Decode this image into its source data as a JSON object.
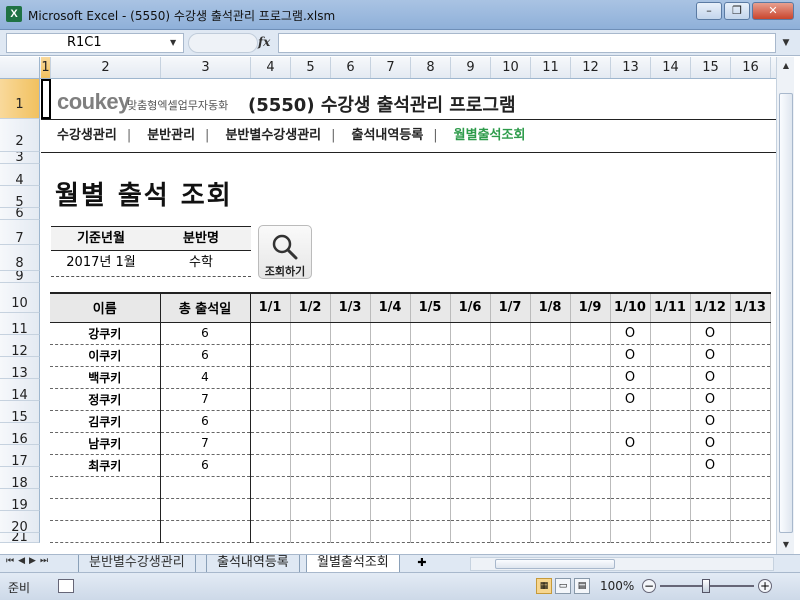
{
  "window": {
    "title": "Microsoft Excel - (5550) 수강생 출석관리 프로그램.xlsm",
    "app_icon": "X",
    "minimize": "–",
    "restore": "❐",
    "close": "✕"
  },
  "formula_bar": {
    "name_box": "R1C1",
    "fx": "fx",
    "formula": ""
  },
  "columns": [
    "1",
    "2",
    "3",
    "4",
    "5",
    "6",
    "7",
    "8",
    "9",
    "10",
    "11",
    "12",
    "13",
    "14",
    "15",
    "16"
  ],
  "rows": [
    "1",
    "2",
    "3",
    "4",
    "5",
    "6",
    "7",
    "8",
    "9",
    "10",
    "11",
    "12",
    "13",
    "14",
    "15",
    "16",
    "17",
    "18",
    "19",
    "20",
    "21"
  ],
  "header": {
    "brand": "coukey",
    "brand_sub": "맞춤형엑셀업무자동화",
    "title": "(5550) 수강생 출석관리 프로그램"
  },
  "menu": {
    "items": [
      "수강생관리",
      "분반관리",
      "분반별수강생관리",
      "출석내역등록",
      "월별출석조회"
    ],
    "separator": "|",
    "active_index": 4
  },
  "page_heading": "월별 출석 조회",
  "filter": {
    "headers": [
      "기준년월",
      "분반명"
    ],
    "values": [
      "2017년 1월",
      "수학"
    ]
  },
  "search_button": {
    "label": "조회하기",
    "icon": "magnifier-icon"
  },
  "attendance": {
    "headers": {
      "name": "이름",
      "total": "총 출석일",
      "days": [
        "1/1",
        "1/2",
        "1/3",
        "1/4",
        "1/5",
        "1/6",
        "1/7",
        "1/8",
        "1/9",
        "1/10",
        "1/11",
        "1/12",
        "1/13"
      ]
    },
    "mark": "O",
    "rows": [
      {
        "name": "강쿠키",
        "total": "6",
        "marks": [
          "",
          "",
          "",
          "",
          "",
          "",
          "",
          "",
          "",
          "O",
          "",
          "O",
          ""
        ]
      },
      {
        "name": "이쿠키",
        "total": "6",
        "marks": [
          "",
          "",
          "",
          "",
          "",
          "",
          "",
          "",
          "",
          "O",
          "",
          "O",
          ""
        ]
      },
      {
        "name": "백쿠키",
        "total": "4",
        "marks": [
          "",
          "",
          "",
          "",
          "",
          "",
          "",
          "",
          "",
          "O",
          "",
          "O",
          ""
        ]
      },
      {
        "name": "정쿠키",
        "total": "7",
        "marks": [
          "",
          "",
          "",
          "",
          "",
          "",
          "",
          "",
          "",
          "O",
          "",
          "O",
          ""
        ]
      },
      {
        "name": "김쿠키",
        "total": "6",
        "marks": [
          "",
          "",
          "",
          "",
          "",
          "",
          "",
          "",
          "",
          "",
          "",
          "O",
          ""
        ]
      },
      {
        "name": "남쿠키",
        "total": "7",
        "marks": [
          "",
          "",
          "",
          "",
          "",
          "",
          "",
          "",
          "",
          "O",
          "",
          "O",
          ""
        ]
      },
      {
        "name": "최쿠키",
        "total": "6",
        "marks": [
          "",
          "",
          "",
          "",
          "",
          "",
          "",
          "",
          "",
          "",
          "",
          "O",
          ""
        ]
      },
      {
        "name": "",
        "total": "",
        "marks": [
          "",
          "",
          "",
          "",
          "",
          "",
          "",
          "",
          "",
          "",
          "",
          "",
          ""
        ]
      },
      {
        "name": "",
        "total": "",
        "marks": [
          "",
          "",
          "",
          "",
          "",
          "",
          "",
          "",
          "",
          "",
          "",
          "",
          ""
        ]
      },
      {
        "name": "",
        "total": "",
        "marks": [
          "",
          "",
          "",
          "",
          "",
          "",
          "",
          "",
          "",
          "",
          "",
          "",
          ""
        ]
      }
    ]
  },
  "sheet_tabs": {
    "tabs": [
      "분반별수강생관리",
      "출석내역등록",
      "월별출석조회"
    ],
    "active_index": 2
  },
  "status": {
    "ready": "준비",
    "zoom": "100%",
    "zoom_minus": "−",
    "zoom_plus": "+"
  },
  "colors": {
    "active_menu": "#2d9b4a",
    "selected_header": "#f1c15f",
    "titlebar": "#a9c3e3"
  }
}
